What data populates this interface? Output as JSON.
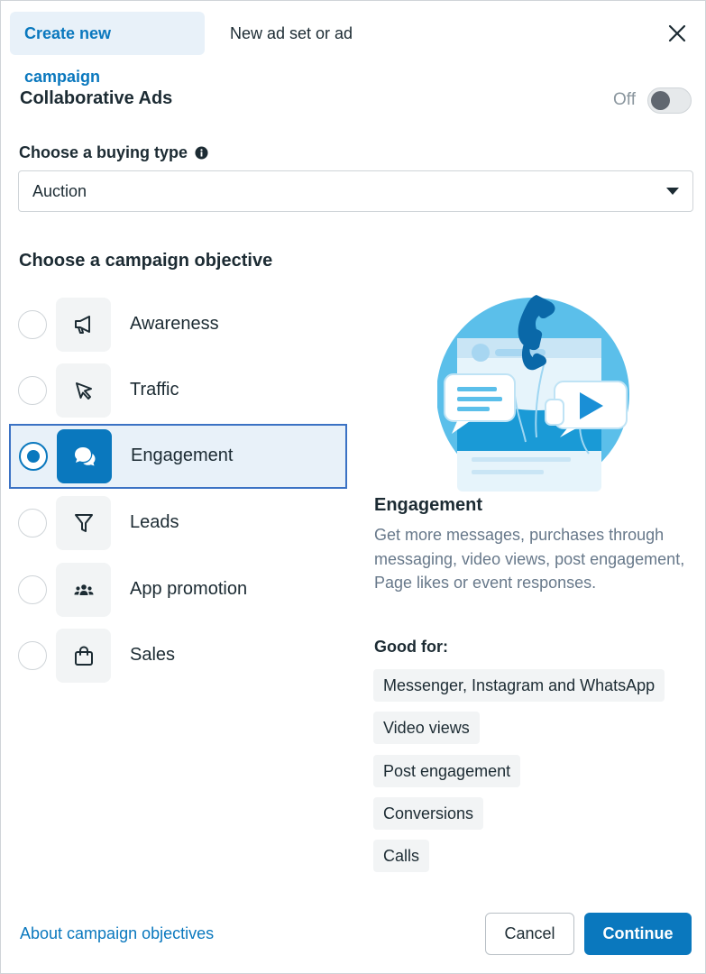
{
  "tabs": {
    "create_new_campaign": "Create new campaign",
    "new_ad_set_or_ad": "New ad set or ad"
  },
  "close_icon": "close-icon",
  "collaborative_ads": {
    "label": "Collaborative Ads",
    "toggle_state": "Off"
  },
  "buying_type": {
    "label": "Choose a buying type",
    "selected": "Auction"
  },
  "objective": {
    "title": "Choose a campaign objective",
    "selected": "Engagement",
    "items": [
      {
        "label": "Awareness",
        "icon": "megaphone-icon"
      },
      {
        "label": "Traffic",
        "icon": "cursor-icon"
      },
      {
        "label": "Engagement",
        "icon": "chat-bubbles-icon"
      },
      {
        "label": "Leads",
        "icon": "filter-icon"
      },
      {
        "label": "App promotion",
        "icon": "people-icon"
      },
      {
        "label": "Sales",
        "icon": "shopping-bag-icon"
      }
    ]
  },
  "description": {
    "title": "Engagement",
    "text": "Get more messages, purchases through messaging, video views, post engagement, Page likes or event responses.",
    "good_for_title": "Good for:",
    "good_for": [
      "Messenger, Instagram and WhatsApp",
      "Video views",
      "Post engagement",
      "Conversions",
      "Calls"
    ]
  },
  "footer": {
    "about_link": "About campaign objectives",
    "cancel": "Cancel",
    "continue": "Continue"
  },
  "colors": {
    "accent": "#0a78be",
    "selected_bg": "#e8f1f9",
    "selected_border": "#3b72c4"
  }
}
